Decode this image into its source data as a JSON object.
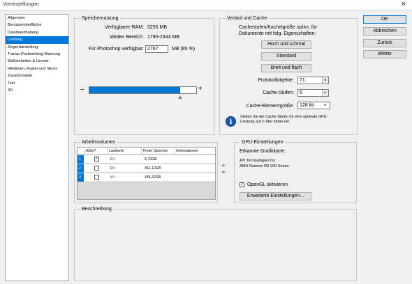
{
  "window": {
    "title": "Voreinstellungen",
    "close_glyph": "✕"
  },
  "sidebar": {
    "items": [
      {
        "label": "Allgemein"
      },
      {
        "label": "Benutzeroberfläche"
      },
      {
        "label": "Dateihandhabung"
      },
      {
        "label": "Leistung",
        "selected": true
      },
      {
        "label": "Zeigerdarstellung"
      },
      {
        "label": "Transp./Farbumfang-Warnung"
      },
      {
        "label": "Maßeinheiten & Lineale"
      },
      {
        "label": "Hilfslinien, Raster und Slices"
      },
      {
        "label": "Zusatzmodule"
      },
      {
        "label": "Text"
      },
      {
        "label": "3D"
      }
    ]
  },
  "memory": {
    "legend": "Speichernutzung",
    "available_label": "Verfügbarer RAM:",
    "available_value": "3255 MB",
    "ideal_label": "Idealer Bereich:",
    "ideal_value": "1790-2343 MB",
    "photoshop_label": "Für Photoshop verfügbar:",
    "photoshop_value": "2767",
    "photoshop_unit": "MB (85 %)",
    "minus": "–",
    "plus": "+",
    "slider_fraction": 0.85
  },
  "cache": {
    "legend": "Verlauf und Cache",
    "description": "Cachestufen/Kachelgröße optim. für Dokumente mit folg. Eigenschaften:",
    "btn_tall": "Hoch und schmal",
    "btn_default": "Standard",
    "btn_wide": "Breit und flach",
    "history_label": "Protokollobjekte:",
    "history_value": "71",
    "levels_label": "Cache-Stufen:",
    "levels_value": "6",
    "tile_label": "Cache-Elementgröße:",
    "tile_value": "128 kb",
    "info_text": "Stellen Sie die Cache-Stufen für eine optimale GPU-Leistung auf 2 oder höher ein.",
    "spin_glyph": "▸",
    "dropdown_glyph": "⌄"
  },
  "volumes": {
    "legend": "Arbeitsvolumes",
    "columns": [
      "Aktiv?",
      "Laufwerk",
      "Freier Speicher",
      "Informationen"
    ],
    "rows": [
      {
        "num": "1",
        "active": true,
        "drive": "C:\\",
        "free": "8,72GB",
        "info": ""
      },
      {
        "num": "2",
        "active": false,
        "drive": "D:\\",
        "free": "461,12GB",
        "info": ""
      },
      {
        "num": "3",
        "active": false,
        "drive": "V:\\",
        "free": "185,32GB",
        "info": ""
      }
    ],
    "check_glyph": "✓"
  },
  "gpu": {
    "legend": "GPU-Einstellungen",
    "detected_label": "Erkannte Grafikkarte:",
    "vendor": "ATI Technologies Inc.",
    "model": "AMD Radeon R9 200 Series",
    "opengl_label": "OpenGL aktivieren",
    "opengl_checked": true,
    "advanced_button": "Erweiterte Einstellungen..."
  },
  "description": {
    "legend": "Beschreibung"
  },
  "actions": {
    "ok": "OK",
    "cancel": "Abbrechen",
    "back": "Zurück",
    "next": "Weiter"
  },
  "colors": {
    "accent": "#0078d7",
    "panel": "#f0f0f0",
    "info_icon": "#1a56b0"
  }
}
